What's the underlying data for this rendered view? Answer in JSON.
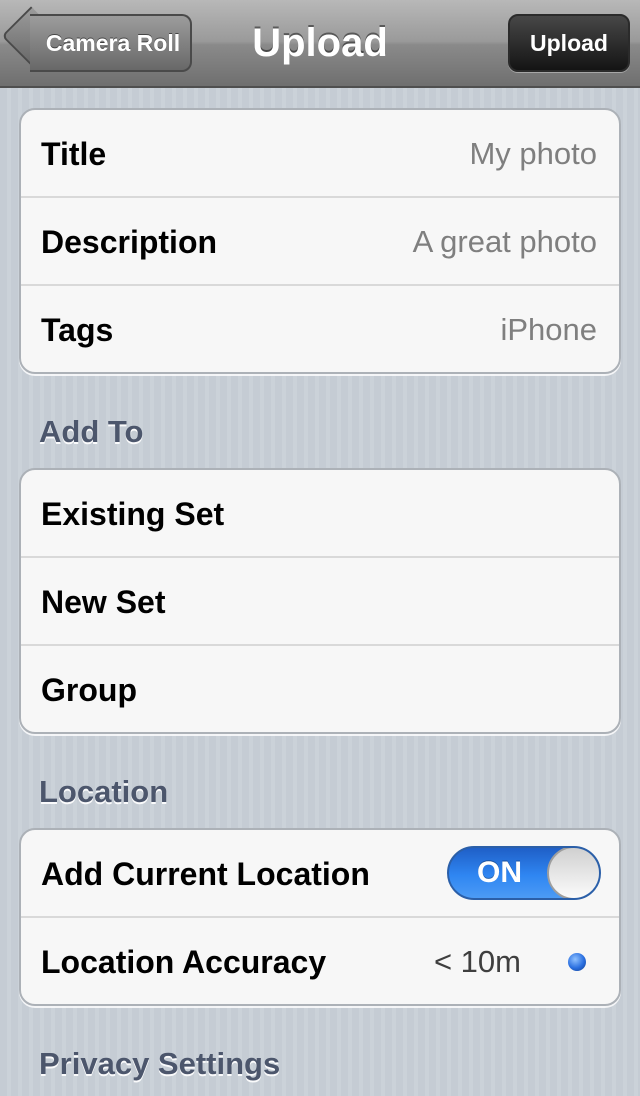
{
  "nav": {
    "title": "Upload",
    "back_label": "Camera Roll",
    "action_label": "Upload"
  },
  "details": [
    {
      "label": "Title",
      "value": "My photo"
    },
    {
      "label": "Description",
      "value": "A great photo"
    },
    {
      "label": "Tags",
      "value": "iPhone"
    }
  ],
  "add_to": {
    "header": "Add To",
    "items": [
      "Existing Set",
      "New Set",
      "Group"
    ]
  },
  "location": {
    "header": "Location",
    "add_current_label": "Add Current Location",
    "toggle_state": "ON",
    "accuracy_label": "Location Accuracy",
    "accuracy_value": "< 10m"
  },
  "privacy": {
    "header": "Privacy Settings"
  },
  "colors": {
    "toggle_on": "#2f86f2",
    "section_header": "#4c566c"
  }
}
